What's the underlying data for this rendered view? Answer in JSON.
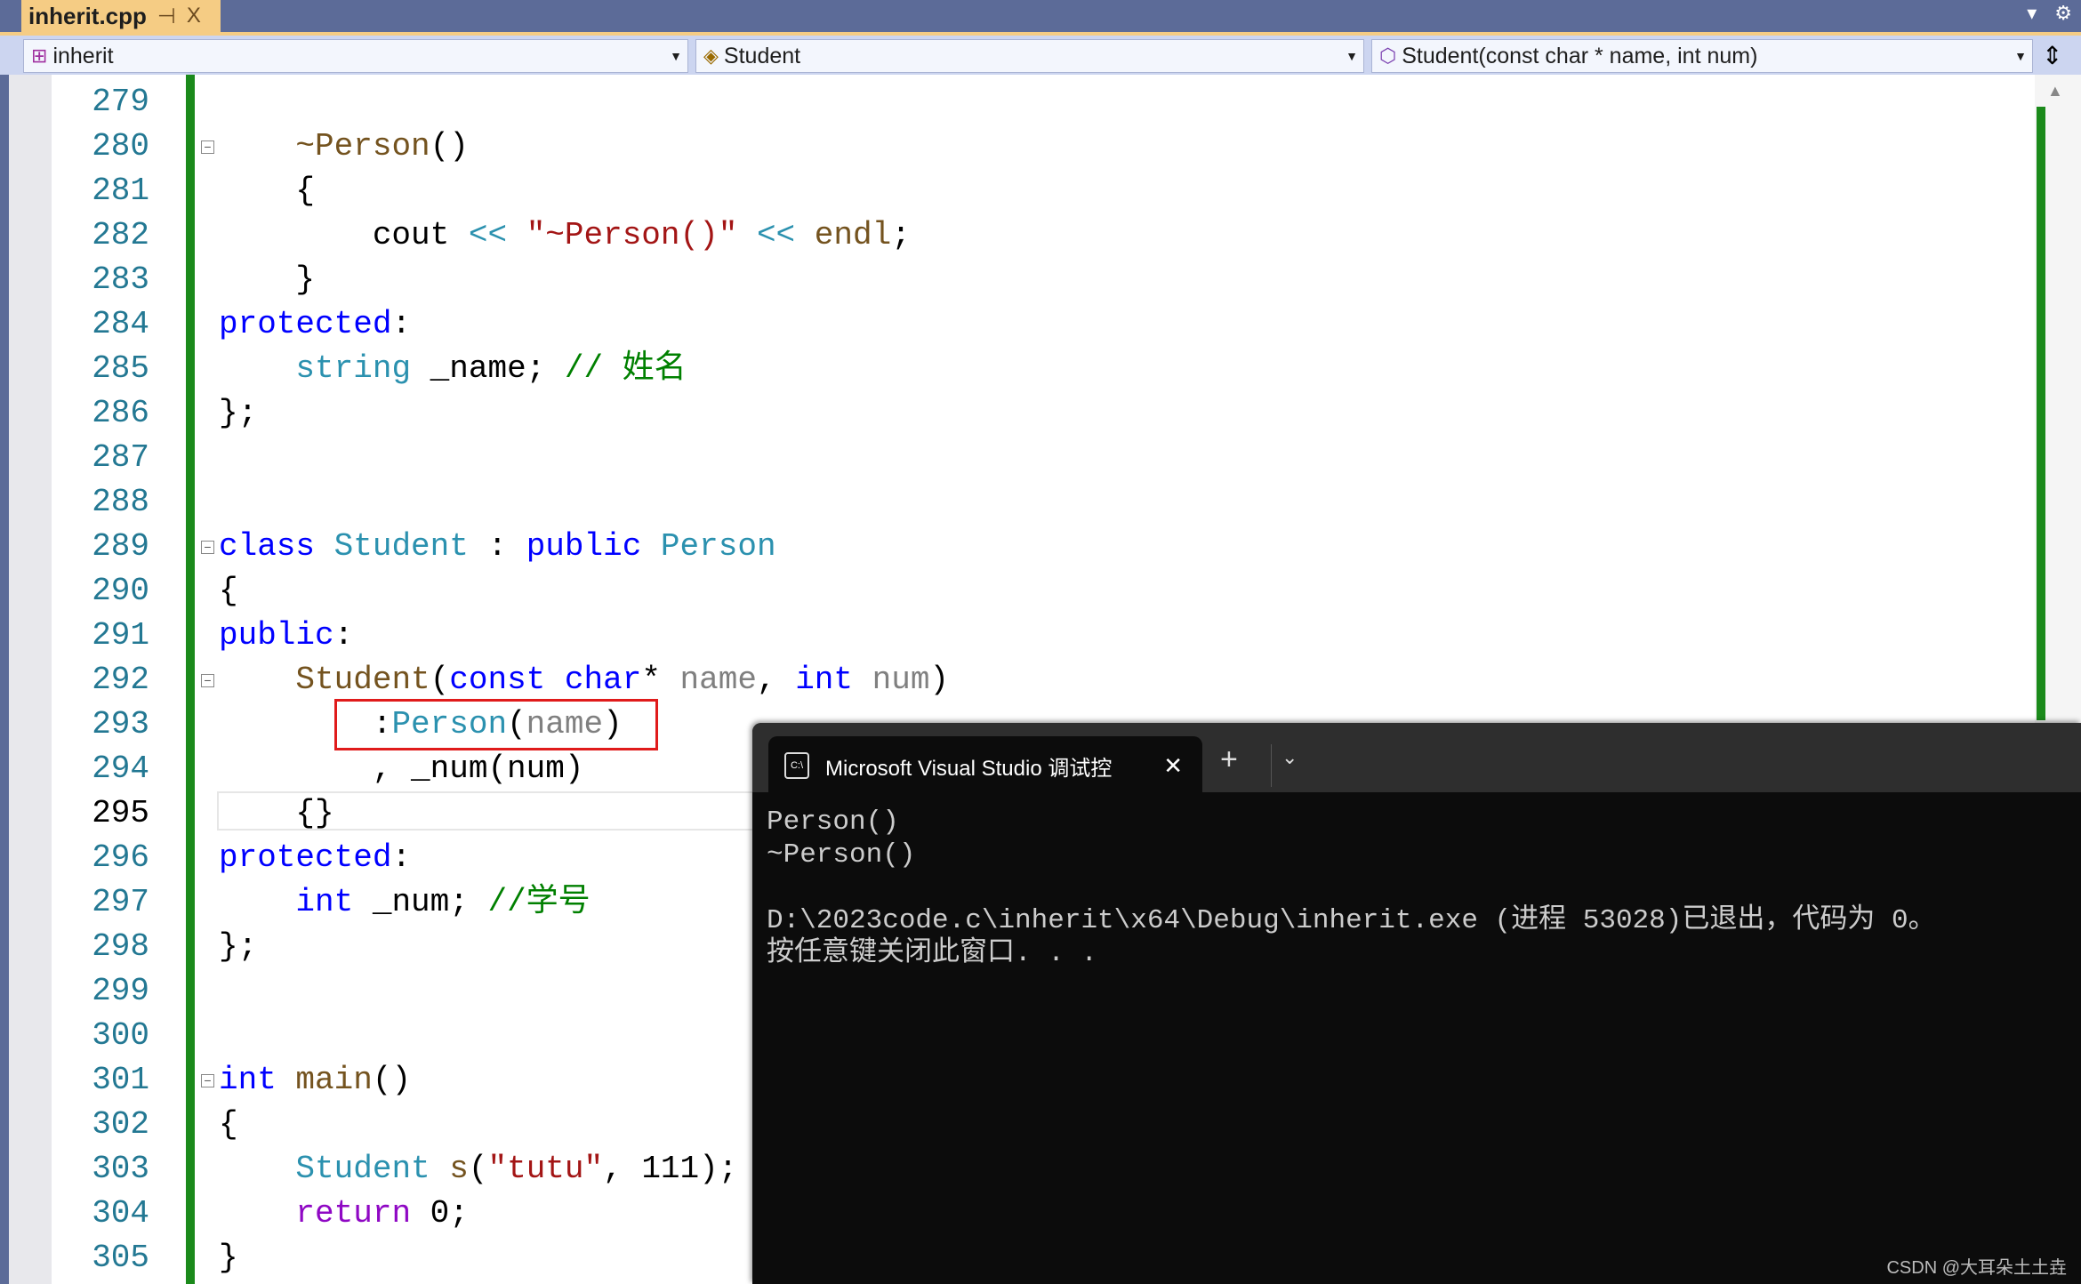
{
  "tab": {
    "filename": "inherit.cpp",
    "pin": "⊣",
    "close": "X"
  },
  "window_buttons": {
    "dropdown": "▾",
    "settings": "⚙"
  },
  "nav": {
    "project": "inherit",
    "class": "Student",
    "member": "Student(const char * name, int num)",
    "split": "⇕"
  },
  "editor": {
    "current_line": 295,
    "fold_lines": [
      280,
      289,
      292,
      301
    ],
    "lines": [
      {
        "n": 279,
        "t": []
      },
      {
        "n": 280,
        "t": [
          [
            "tx",
            "    "
          ],
          [
            "fn",
            "~Person"
          ],
          [
            "tx",
            "()"
          ]
        ]
      },
      {
        "n": 281,
        "t": [
          [
            "tx",
            "    {"
          ]
        ]
      },
      {
        "n": 282,
        "t": [
          [
            "tx",
            "        cout "
          ],
          [
            "ty",
            "<<"
          ],
          [
            "tx",
            " "
          ],
          [
            "st",
            "\"~Person()\""
          ],
          [
            "tx",
            " "
          ],
          [
            "ty",
            "<<"
          ],
          [
            "tx",
            " "
          ],
          [
            "fn",
            "endl"
          ],
          [
            "tx",
            ";"
          ]
        ]
      },
      {
        "n": 283,
        "t": [
          [
            "tx",
            "    }"
          ]
        ]
      },
      {
        "n": 284,
        "t": [
          [
            "kw",
            "protected"
          ],
          [
            "tx",
            ":"
          ]
        ]
      },
      {
        "n": 285,
        "t": [
          [
            "tx",
            "    "
          ],
          [
            "ty",
            "string"
          ],
          [
            "tx",
            " _name; "
          ],
          [
            "cm",
            "// 姓名"
          ]
        ]
      },
      {
        "n": 286,
        "t": [
          [
            "tx",
            "};"
          ]
        ]
      },
      {
        "n": 287,
        "t": []
      },
      {
        "n": 288,
        "t": []
      },
      {
        "n": 289,
        "t": [
          [
            "kw",
            "class"
          ],
          [
            "tx",
            " "
          ],
          [
            "ty",
            "Student"
          ],
          [
            "tx",
            " : "
          ],
          [
            "kw",
            "public"
          ],
          [
            "tx",
            " "
          ],
          [
            "ty",
            "Person"
          ]
        ]
      },
      {
        "n": 290,
        "t": [
          [
            "tx",
            "{"
          ]
        ]
      },
      {
        "n": 291,
        "t": [
          [
            "kw",
            "public"
          ],
          [
            "tx",
            ":"
          ]
        ]
      },
      {
        "n": 292,
        "t": [
          [
            "tx",
            "    "
          ],
          [
            "fn",
            "Student"
          ],
          [
            "tx",
            "("
          ],
          [
            "kw",
            "const"
          ],
          [
            "tx",
            " "
          ],
          [
            "kw",
            "char"
          ],
          [
            "tx",
            "* "
          ],
          [
            "pa",
            "name"
          ],
          [
            "tx",
            ", "
          ],
          [
            "kw",
            "int"
          ],
          [
            "tx",
            " "
          ],
          [
            "pa",
            "num"
          ],
          [
            "tx",
            ")"
          ]
        ]
      },
      {
        "n": 293,
        "t": [
          [
            "tx",
            "        :"
          ],
          [
            "ty",
            "Person"
          ],
          [
            "tx",
            "("
          ],
          [
            "pa",
            "name"
          ],
          [
            "tx",
            ")"
          ]
        ]
      },
      {
        "n": 294,
        "t": [
          [
            "tx",
            "        , _num(num)"
          ]
        ]
      },
      {
        "n": 295,
        "t": [
          [
            "tx",
            "    {}"
          ]
        ]
      },
      {
        "n": 296,
        "t": [
          [
            "kw",
            "protected"
          ],
          [
            "tx",
            ":"
          ]
        ]
      },
      {
        "n": 297,
        "t": [
          [
            "tx",
            "    "
          ],
          [
            "kw",
            "int"
          ],
          [
            "tx",
            " _num; "
          ],
          [
            "cm",
            "//学号"
          ]
        ]
      },
      {
        "n": 298,
        "t": [
          [
            "tx",
            "};"
          ]
        ]
      },
      {
        "n": 299,
        "t": []
      },
      {
        "n": 300,
        "t": []
      },
      {
        "n": 301,
        "t": [
          [
            "kw",
            "int"
          ],
          [
            "tx",
            " "
          ],
          [
            "fn",
            "main"
          ],
          [
            "tx",
            "()"
          ]
        ]
      },
      {
        "n": 302,
        "t": [
          [
            "tx",
            "{"
          ]
        ]
      },
      {
        "n": 303,
        "t": [
          [
            "tx",
            "    "
          ],
          [
            "ty",
            "Student"
          ],
          [
            "tx",
            " "
          ],
          [
            "fn",
            "s"
          ],
          [
            "tx",
            "("
          ],
          [
            "st",
            "\"tutu\""
          ],
          [
            "tx",
            ", 111);"
          ]
        ]
      },
      {
        "n": 304,
        "t": [
          [
            "tx",
            "    "
          ],
          [
            "rt",
            "return"
          ],
          [
            "tx",
            " 0;"
          ]
        ]
      },
      {
        "n": 305,
        "t": [
          [
            "tx",
            "}"
          ]
        ]
      }
    ]
  },
  "terminal": {
    "tab_title": "Microsoft Visual Studio 调试控",
    "icon_text": "C:\\",
    "close": "✕",
    "new_tab": "+",
    "dropdown": "⌄",
    "output": "Person()\n~Person()\n\nD:\\2023code.c\\inherit\\x64\\Debug\\inherit.exe (进程 53028)已退出，代码为 0。\n按任意键关闭此窗口. . ."
  },
  "watermark": "CSDN @大耳朵土土垚"
}
